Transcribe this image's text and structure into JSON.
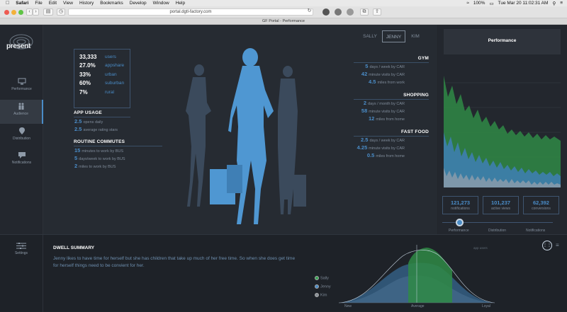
{
  "menubar": {
    "app": "Safari",
    "items": [
      "File",
      "Edit",
      "View",
      "History",
      "Bookmarks",
      "Develop",
      "Window",
      "Help"
    ],
    "battery": "100%",
    "clock": "Tue Mar 20  11:02:31 AM"
  },
  "browser": {
    "url": "portal.dgtl-factory.com",
    "tab_title": "GF Portal - Performance"
  },
  "sidebar": {
    "logo": "present",
    "items": [
      {
        "label": "Performance",
        "icon": "monitor-icon"
      },
      {
        "label": "Audience",
        "icon": "people-icon"
      },
      {
        "label": "Distribution",
        "icon": "location-pin-icon"
      },
      {
        "label": "Notifications",
        "icon": "chat-bubble-icon"
      }
    ],
    "settings_label": "Settings"
  },
  "persona_tabs": [
    "SALLY",
    "JENNY",
    "KIM"
  ],
  "stats": [
    {
      "value": "33,333",
      "label": "users"
    },
    {
      "value": "27.0%",
      "label": "appshare"
    },
    {
      "value": "33%",
      "label": "urban"
    },
    {
      "value": "60%",
      "label": "suburban"
    },
    {
      "value": "7%",
      "label": "rural"
    }
  ],
  "app_usage": {
    "title": "APP USAGE",
    "rows": [
      {
        "value": "2.5",
        "text": "opens daily"
      },
      {
        "value": "2.5",
        "text": "average rating stars"
      }
    ]
  },
  "routine_commutes": {
    "title": "ROUTINE COMMUTES",
    "rows": [
      {
        "value": "15",
        "text": "minutes to work by BUS"
      },
      {
        "value": "5",
        "text": "days/week to work by BUS"
      },
      {
        "value": "2",
        "text": "miles to work by BUS"
      }
    ]
  },
  "gym": {
    "title": "GYM",
    "rows": [
      {
        "value": "5",
        "text": "days / week by CAR"
      },
      {
        "value": "42",
        "text": "minute visits by CAR"
      },
      {
        "value": "4.5",
        "text": "miles from work"
      }
    ]
  },
  "shopping": {
    "title": "SHOPPING",
    "rows": [
      {
        "value": "2",
        "text": "days / month by CAR"
      },
      {
        "value": "58",
        "text": "minute visits by CAR"
      },
      {
        "value": "12",
        "text": "miles from home"
      }
    ]
  },
  "fast_food": {
    "title": "FAST FOOD",
    "rows": [
      {
        "value": "2.5",
        "text": "days / week by CAR"
      },
      {
        "value": "4.25",
        "text": "minute visits by CAR"
      },
      {
        "value": "0.5",
        "text": "miles from home"
      }
    ]
  },
  "performance": {
    "title": "Performance",
    "kpis": [
      {
        "value": "121,273",
        "label": "notifications"
      },
      {
        "value": "101,237",
        "label": "active views"
      },
      {
        "value": "62,392",
        "label": "conversions"
      }
    ],
    "slider_labels": [
      "Performance",
      "Distribution",
      "Notifications"
    ]
  },
  "dwell": {
    "title": "DWELL SUMMARY",
    "text": "Jenny likes to have time for herself but she has children that take up much of her free time. So when she does get time for herself things need to be convient for her.",
    "legend": [
      "Sally",
      "Jenny",
      "Kim"
    ],
    "axis": [
      "New",
      "Average",
      "Loyal"
    ],
    "chart_caption": "app users"
  },
  "colors": {
    "accent": "#4a8cc7",
    "green": "#3aa655",
    "background": "#21252b"
  }
}
